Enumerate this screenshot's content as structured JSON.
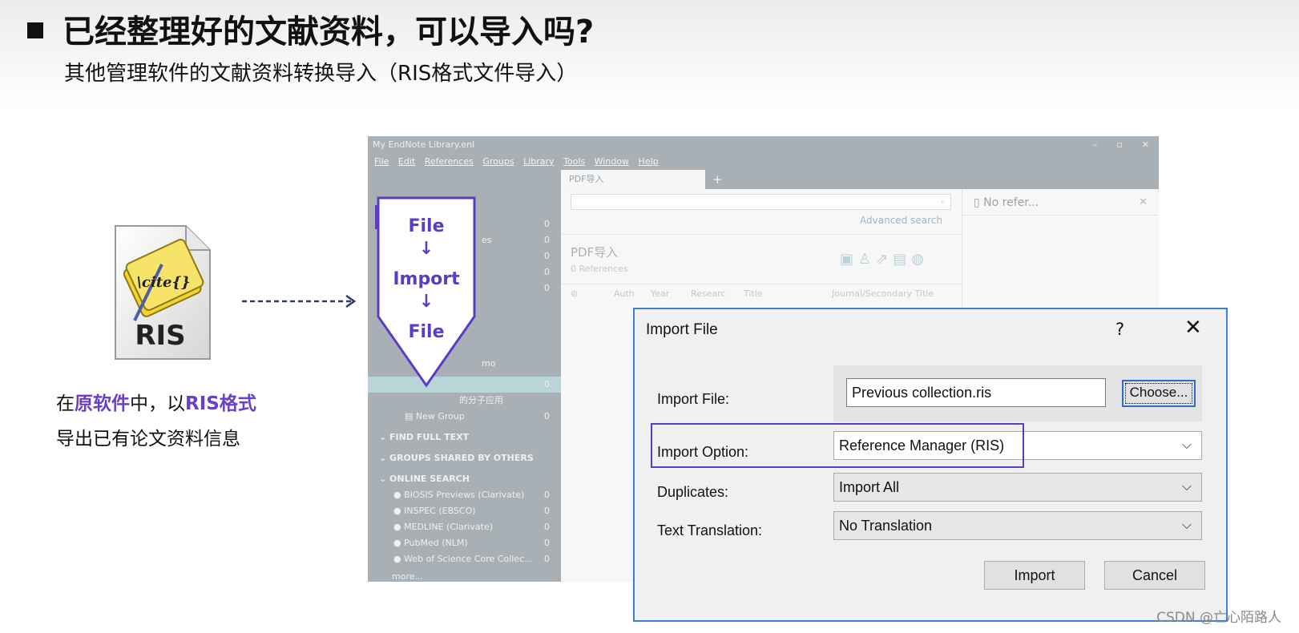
{
  "slide": {
    "title": "已经整理好的文献资料，可以导入吗?",
    "subtitle": "其他管理软件的文献资料转换导入（RIS格式文件导入）",
    "ris_icon_label": "RIS",
    "ris_icon_text": "\\cite{}",
    "instruction": {
      "p1": "在",
      "p2": "原软件",
      "p3": "中，以",
      "p4": "RIS格式",
      "line2": "导出已有论文资料信息"
    },
    "callout": {
      "step1": "File",
      "step2": "Import",
      "step3": "File"
    },
    "watermark": "CSDN @亡心陌路人",
    "accent_color": "#5b3cc4"
  },
  "endnote": {
    "window_title": "My EndNote Library.enl",
    "menu": [
      "File",
      "Edit",
      "References",
      "Groups",
      "Library",
      "Tools",
      "Window",
      "Help"
    ],
    "tab_label": "PDF导入",
    "tab_add": "+",
    "advanced_search": "Advanced search",
    "group_title": "PDF导入",
    "group_count": "0 References",
    "columns": [
      "Auth",
      "Year",
      "Researc",
      "Title",
      "Journal/Secondary Title"
    ],
    "preview_text": "No refer...",
    "sidebar": {
      "counts_top": [
        "0",
        "0",
        "0",
        "0",
        "0"
      ],
      "partial_label": "es",
      "partial_memo": "mo",
      "selected_count": "0",
      "subgroup_label": "的分子应用",
      "new_group": "New Group",
      "new_group_count": "0",
      "find_full_text": "FIND FULL TEXT",
      "groups_shared": "GROUPS SHARED BY OTHERS",
      "online_search": "ONLINE SEARCH",
      "online_items": [
        {
          "label": "BIOSIS Previews (Clarivate)",
          "count": "0"
        },
        {
          "label": "INSPEC (EBSCO)",
          "count": "0"
        },
        {
          "label": "MEDLINE (Clarivate)",
          "count": "0"
        },
        {
          "label": "PubMed (NLM)",
          "count": "0"
        },
        {
          "label": "Web of Science Core Collec...",
          "count": "0"
        }
      ],
      "more": "more..."
    }
  },
  "dialog": {
    "title": "Import File",
    "help": "?",
    "close": "✕",
    "import_file_label": "Import File:",
    "import_file_value": "Previous collection.ris",
    "choose_label": "Choose...",
    "import_option_label": "Import Option:",
    "import_option_value": "Reference Manager (RIS)",
    "duplicates_label": "Duplicates:",
    "duplicates_value": "Import All",
    "translation_label": "Text Translation:",
    "translation_value": "No Translation",
    "import_button": "Import",
    "cancel_button": "Cancel"
  }
}
